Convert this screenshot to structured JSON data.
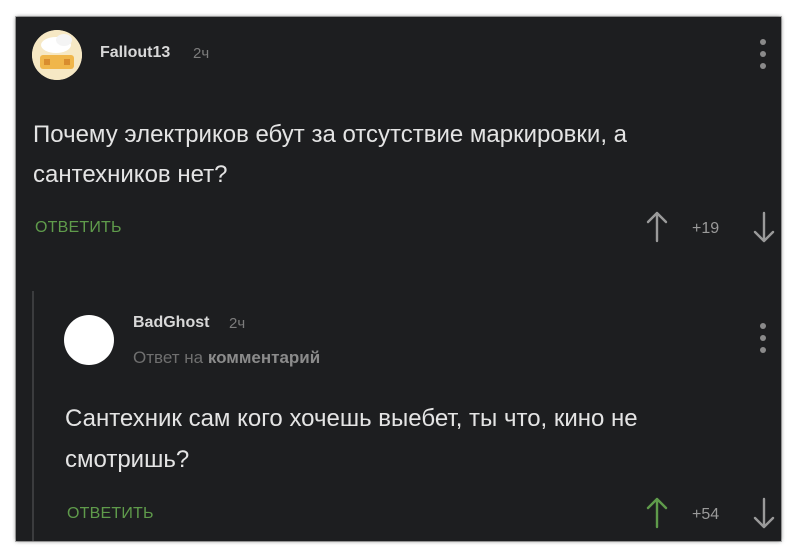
{
  "comment": {
    "username": "Fallout13",
    "time": "2ч",
    "text_line1": "Почему электриков ебут за отсутствие маркировки, а",
    "text_line2": "сантехников нет?",
    "reply_label": "ОТВЕТИТЬ",
    "rating": "+19",
    "upvote_color": "#9a9a9a"
  },
  "reply_comment": {
    "username": "BadGhost",
    "time": "2ч",
    "reply_to_prefix": "Ответ на",
    "reply_to_link": "комментарий",
    "text_line1": "Сантехник сам кого хочешь выебет, ты что, кино не",
    "text_line2": "смотришь?",
    "reply_label": "ОТВЕТИТЬ",
    "rating": "+54",
    "upvote_color": "#5f9b4b"
  },
  "icons": {
    "upvote": "arrow-up-icon",
    "downvote": "arrow-down-icon",
    "menu": "more-vertical-icon"
  }
}
